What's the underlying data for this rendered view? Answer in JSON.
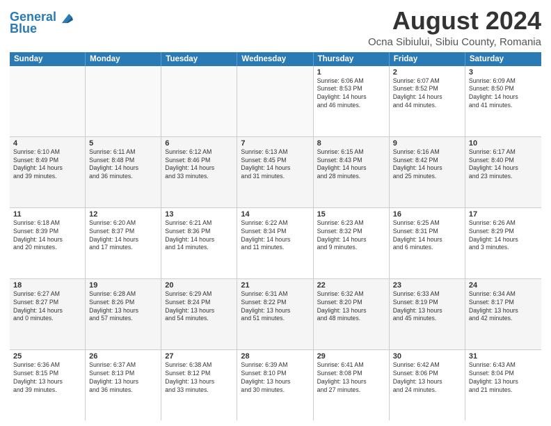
{
  "logo": {
    "line1": "General",
    "line2": "Blue"
  },
  "title": "August 2024",
  "subtitle": "Ocna Sibiului, Sibiu County, Romania",
  "header_days": [
    "Sunday",
    "Monday",
    "Tuesday",
    "Wednesday",
    "Thursday",
    "Friday",
    "Saturday"
  ],
  "rows": [
    [
      {
        "num": "",
        "text": "",
        "empty": true
      },
      {
        "num": "",
        "text": "",
        "empty": true
      },
      {
        "num": "",
        "text": "",
        "empty": true
      },
      {
        "num": "",
        "text": "",
        "empty": true
      },
      {
        "num": "1",
        "text": "Sunrise: 6:06 AM\nSunset: 8:53 PM\nDaylight: 14 hours\nand 46 minutes.",
        "empty": false
      },
      {
        "num": "2",
        "text": "Sunrise: 6:07 AM\nSunset: 8:52 PM\nDaylight: 14 hours\nand 44 minutes.",
        "empty": false
      },
      {
        "num": "3",
        "text": "Sunrise: 6:09 AM\nSunset: 8:50 PM\nDaylight: 14 hours\nand 41 minutes.",
        "empty": false
      }
    ],
    [
      {
        "num": "4",
        "text": "Sunrise: 6:10 AM\nSunset: 8:49 PM\nDaylight: 14 hours\nand 39 minutes.",
        "empty": false
      },
      {
        "num": "5",
        "text": "Sunrise: 6:11 AM\nSunset: 8:48 PM\nDaylight: 14 hours\nand 36 minutes.",
        "empty": false
      },
      {
        "num": "6",
        "text": "Sunrise: 6:12 AM\nSunset: 8:46 PM\nDaylight: 14 hours\nand 33 minutes.",
        "empty": false
      },
      {
        "num": "7",
        "text": "Sunrise: 6:13 AM\nSunset: 8:45 PM\nDaylight: 14 hours\nand 31 minutes.",
        "empty": false
      },
      {
        "num": "8",
        "text": "Sunrise: 6:15 AM\nSunset: 8:43 PM\nDaylight: 14 hours\nand 28 minutes.",
        "empty": false
      },
      {
        "num": "9",
        "text": "Sunrise: 6:16 AM\nSunset: 8:42 PM\nDaylight: 14 hours\nand 25 minutes.",
        "empty": false
      },
      {
        "num": "10",
        "text": "Sunrise: 6:17 AM\nSunset: 8:40 PM\nDaylight: 14 hours\nand 23 minutes.",
        "empty": false
      }
    ],
    [
      {
        "num": "11",
        "text": "Sunrise: 6:18 AM\nSunset: 8:39 PM\nDaylight: 14 hours\nand 20 minutes.",
        "empty": false
      },
      {
        "num": "12",
        "text": "Sunrise: 6:20 AM\nSunset: 8:37 PM\nDaylight: 14 hours\nand 17 minutes.",
        "empty": false
      },
      {
        "num": "13",
        "text": "Sunrise: 6:21 AM\nSunset: 8:36 PM\nDaylight: 14 hours\nand 14 minutes.",
        "empty": false
      },
      {
        "num": "14",
        "text": "Sunrise: 6:22 AM\nSunset: 8:34 PM\nDaylight: 14 hours\nand 11 minutes.",
        "empty": false
      },
      {
        "num": "15",
        "text": "Sunrise: 6:23 AM\nSunset: 8:32 PM\nDaylight: 14 hours\nand 9 minutes.",
        "empty": false
      },
      {
        "num": "16",
        "text": "Sunrise: 6:25 AM\nSunset: 8:31 PM\nDaylight: 14 hours\nand 6 minutes.",
        "empty": false
      },
      {
        "num": "17",
        "text": "Sunrise: 6:26 AM\nSunset: 8:29 PM\nDaylight: 14 hours\nand 3 minutes.",
        "empty": false
      }
    ],
    [
      {
        "num": "18",
        "text": "Sunrise: 6:27 AM\nSunset: 8:27 PM\nDaylight: 14 hours\nand 0 minutes.",
        "empty": false
      },
      {
        "num": "19",
        "text": "Sunrise: 6:28 AM\nSunset: 8:26 PM\nDaylight: 13 hours\nand 57 minutes.",
        "empty": false
      },
      {
        "num": "20",
        "text": "Sunrise: 6:29 AM\nSunset: 8:24 PM\nDaylight: 13 hours\nand 54 minutes.",
        "empty": false
      },
      {
        "num": "21",
        "text": "Sunrise: 6:31 AM\nSunset: 8:22 PM\nDaylight: 13 hours\nand 51 minutes.",
        "empty": false
      },
      {
        "num": "22",
        "text": "Sunrise: 6:32 AM\nSunset: 8:20 PM\nDaylight: 13 hours\nand 48 minutes.",
        "empty": false
      },
      {
        "num": "23",
        "text": "Sunrise: 6:33 AM\nSunset: 8:19 PM\nDaylight: 13 hours\nand 45 minutes.",
        "empty": false
      },
      {
        "num": "24",
        "text": "Sunrise: 6:34 AM\nSunset: 8:17 PM\nDaylight: 13 hours\nand 42 minutes.",
        "empty": false
      }
    ],
    [
      {
        "num": "25",
        "text": "Sunrise: 6:36 AM\nSunset: 8:15 PM\nDaylight: 13 hours\nand 39 minutes.",
        "empty": false
      },
      {
        "num": "26",
        "text": "Sunrise: 6:37 AM\nSunset: 8:13 PM\nDaylight: 13 hours\nand 36 minutes.",
        "empty": false
      },
      {
        "num": "27",
        "text": "Sunrise: 6:38 AM\nSunset: 8:12 PM\nDaylight: 13 hours\nand 33 minutes.",
        "empty": false
      },
      {
        "num": "28",
        "text": "Sunrise: 6:39 AM\nSunset: 8:10 PM\nDaylight: 13 hours\nand 30 minutes.",
        "empty": false
      },
      {
        "num": "29",
        "text": "Sunrise: 6:41 AM\nSunset: 8:08 PM\nDaylight: 13 hours\nand 27 minutes.",
        "empty": false
      },
      {
        "num": "30",
        "text": "Sunrise: 6:42 AM\nSunset: 8:06 PM\nDaylight: 13 hours\nand 24 minutes.",
        "empty": false
      },
      {
        "num": "31",
        "text": "Sunrise: 6:43 AM\nSunset: 8:04 PM\nDaylight: 13 hours\nand 21 minutes.",
        "empty": false
      }
    ]
  ]
}
